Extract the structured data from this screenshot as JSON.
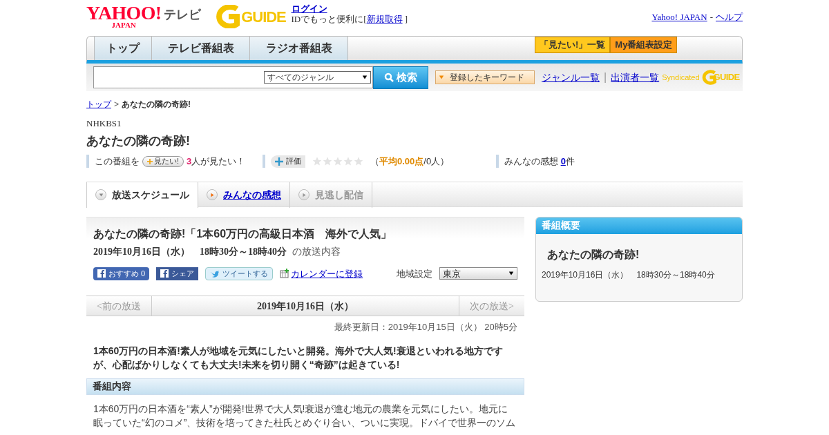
{
  "header": {
    "logo": {
      "yahoo": "YAHOO!",
      "japan": "JAPAN",
      "service": "テレビ",
      "guide": "GUIDE"
    },
    "login": "ログイン",
    "signup_prefix": "IDでもっと便利に[",
    "signup_link": "新規取得",
    "signup_suffix": "]",
    "links": [
      "Yahoo! JAPAN",
      "ヘルプ"
    ],
    "links_separator": "-"
  },
  "nav": {
    "tabs": [
      {
        "label": "トップ",
        "selected": false
      },
      {
        "label": "テレビ番組表",
        "selected": false
      },
      {
        "label": "ラジオ番組表",
        "selected": false
      }
    ],
    "buttons": [
      {
        "label": "「見たい!」一覧",
        "color": "#ffc81e"
      },
      {
        "label": "My番組表設定",
        "color": "#ff9e1a"
      }
    ]
  },
  "search": {
    "genre": "すべてのジャンル",
    "button": "検索",
    "keyword_button": "登録したキーワード",
    "links": [
      "ジャンル一覧",
      "出演者一覧"
    ],
    "links_separator": "|",
    "syndicated": "Syndicated",
    "guide": "GUIDE"
  },
  "breadcrumb": {
    "link": "トップ",
    "separator": ">",
    "current": "あなたの隣の奇跡!"
  },
  "channel": "NHKBS1",
  "title": "あなたの隣の奇跡!",
  "info": {
    "want_prefix": "この番組を",
    "want_button": "見たい!",
    "want_count": "3",
    "want_suffix": "人が見たい！",
    "rate_button": "評価",
    "stars": 0,
    "average_open": "（",
    "average": "平均0.00点",
    "average_rest": "/0人）",
    "reviews_label": "みんなの感想",
    "reviews_count": "0",
    "reviews_suffix": "件"
  },
  "tabs": [
    {
      "label": "放送スケジュール",
      "selected": true,
      "disabled": false
    },
    {
      "label": "みんなの感想",
      "selected": false,
      "disabled": false
    },
    {
      "label": "見逃し配信",
      "selected": false,
      "disabled": true
    }
  ],
  "episode": {
    "title": "あなたの隣の奇跡!「1本60万円の高級日本酒　海外で人気」",
    "datetime": "2019年10月16日（水）　18時30分～18時40分",
    "datetime_suffix": "の放送内容",
    "share": [
      {
        "kind": "facebook-like",
        "label": "おすすめ",
        "count": "0"
      },
      {
        "kind": "facebook-share",
        "label": "シェア"
      },
      {
        "kind": "tweet",
        "label": "ツイートする"
      }
    ],
    "calendar": "カレンダーに登録",
    "region_label": "地域設定",
    "region": "東京"
  },
  "pager": {
    "prev": "<前の放送",
    "date": "2019年10月16日（水）",
    "next": "次の放送>"
  },
  "updated": "最終更新日：2019年10月15日（火） 20時5分",
  "lead": "1本60万円の日本酒!素人が地域を元気にしたいと開発。海外で大人気!衰退といわれる地方ですが、心配ばかりしなくても大丈夫!未来を切り開く“奇跡”は起きている!",
  "section": {
    "heading": "番組内容",
    "lines": [
      "1本60万円の日本酒を“素人”が開発!世界で大人気!衰退が進む地元の農業を元気にしたい。地元に",
      "眠っていた“幻のコメ”、技術を培ってきた杜氏とめぐり合い、ついに実現。ドバイで世界一のソム"
    ]
  },
  "summary": {
    "heading": "番組概要",
    "title": "あなたの隣の奇跡!",
    "datetime": "2019年10月16日（水）　18時30分～18時40分"
  }
}
